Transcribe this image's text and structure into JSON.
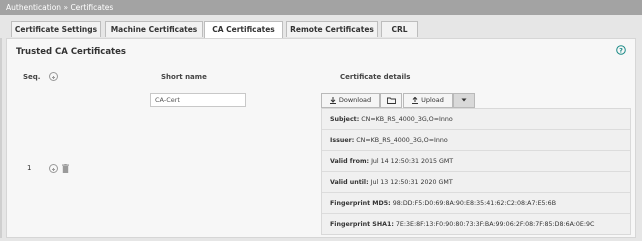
{
  "breadcrumb": {
    "section": "Authentication",
    "separator": "»",
    "page": "Certificates"
  },
  "tabs": [
    {
      "label": "Certificate Settings",
      "active": false
    },
    {
      "label": "Machine Certificates",
      "active": false
    },
    {
      "label": "CA Certificates",
      "active": true
    },
    {
      "label": "Remote Certificates",
      "active": false
    },
    {
      "label": "CRL",
      "active": false
    }
  ],
  "panel": {
    "title": "Trusted CA Certificates"
  },
  "columns": {
    "seq": "Seq.",
    "short_name": "Short name",
    "details": "Certificate details"
  },
  "certificate": {
    "seq": "1",
    "short_name": "CA-Cert",
    "buttons": {
      "download": "Download",
      "upload": "Upload"
    },
    "details": [
      {
        "label": "Subject:",
        "value": "CN=KB_RS_4000_3G,O=Inno"
      },
      {
        "label": "Issuer:",
        "value": "CN=KB_RS_4000_3G,O=Inno"
      },
      {
        "label": "Valid from:",
        "value": "Jul 14 12:50:31 2015 GMT"
      },
      {
        "label": "Valid until:",
        "value": "Jul 13 12:50:31 2020 GMT"
      },
      {
        "label": "Fingerprint MD5:",
        "value": "98:DD:F5:D0:69:8A:90:E8:35:41:62:C2:08:A7:E5:6B"
      },
      {
        "label": "Fingerprint SHA1:",
        "value": "7E:3E:8F:13:F0:90:80:73:3F:BA:99:06:2F:08:7F:85:D8:6A:0E:9C"
      }
    ]
  },
  "colors": {
    "accent": "#1a8a86",
    "topbar": "#a3a3a3"
  }
}
